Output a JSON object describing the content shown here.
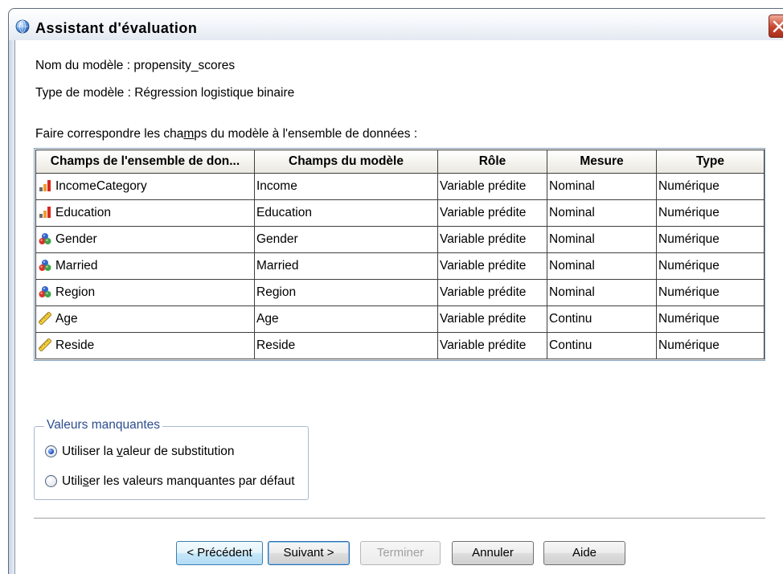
{
  "window": {
    "title": "Assistant d'évaluation",
    "icon": "scoring-wizard-icon",
    "close_icon": "close-icon"
  },
  "model": {
    "name_line": "Nom du modèle : propensity_scores",
    "type_line": "Type de modèle : Régression logistique binaire"
  },
  "mapping": {
    "label": {
      "before": "Faire correspondre les cha",
      "key": "m",
      "after": "ps du modèle à l'ensemble de données :"
    },
    "columns": [
      "Champs de l'ensemble de don...",
      "Champs du modèle",
      "Rôle",
      "Mesure",
      "Type"
    ],
    "rows": [
      {
        "dataset_field": "IncomeCategory",
        "icon": "ordinal-icon",
        "model_field": "Income",
        "role": "Variable prédite",
        "measure": "Nominal",
        "type": "Numérique"
      },
      {
        "dataset_field": "Education",
        "icon": "ordinal-icon",
        "model_field": "Education",
        "role": "Variable prédite",
        "measure": "Nominal",
        "type": "Numérique"
      },
      {
        "dataset_field": "Gender",
        "icon": "nominal-icon",
        "model_field": "Gender",
        "role": "Variable prédite",
        "measure": "Nominal",
        "type": "Numérique"
      },
      {
        "dataset_field": "Married",
        "icon": "nominal-icon",
        "model_field": "Married",
        "role": "Variable prédite",
        "measure": "Nominal",
        "type": "Numérique"
      },
      {
        "dataset_field": "Region",
        "icon": "nominal-icon",
        "model_field": "Region",
        "role": "Variable prédite",
        "measure": "Nominal",
        "type": "Numérique"
      },
      {
        "dataset_field": "Age",
        "icon": "scale-icon",
        "model_field": "Age",
        "role": "Variable prédite",
        "measure": "Continu",
        "type": "Numérique"
      },
      {
        "dataset_field": "Reside",
        "icon": "scale-icon",
        "model_field": "Reside",
        "role": "Variable prédite",
        "measure": "Continu",
        "type": "Numérique"
      }
    ]
  },
  "missing_values": {
    "legend": "Valeurs manquantes",
    "options": [
      {
        "before": "Utiliser la ",
        "key": "v",
        "after": "aleur de substitution",
        "selected": true
      },
      {
        "before": "Utili",
        "key": "s",
        "after": "er les valeurs manquantes par défaut",
        "selected": false
      }
    ]
  },
  "buttons": {
    "back": {
      "label": "< Précédent",
      "disabled": false
    },
    "next": {
      "label": "Suivant >",
      "disabled": false
    },
    "finish": {
      "label": "Terminer",
      "disabled": true
    },
    "cancel": {
      "label": "Annuler",
      "disabled": false
    },
    "help": {
      "label": "Aide",
      "disabled": false
    }
  },
  "theme": {
    "legend_text": "#2c4d8f",
    "grid_lines": "#3f3f3f",
    "grid_frame": "#7f9db9",
    "close_button": "#c8442f",
    "radio_selected": "#1c4fb8"
  }
}
